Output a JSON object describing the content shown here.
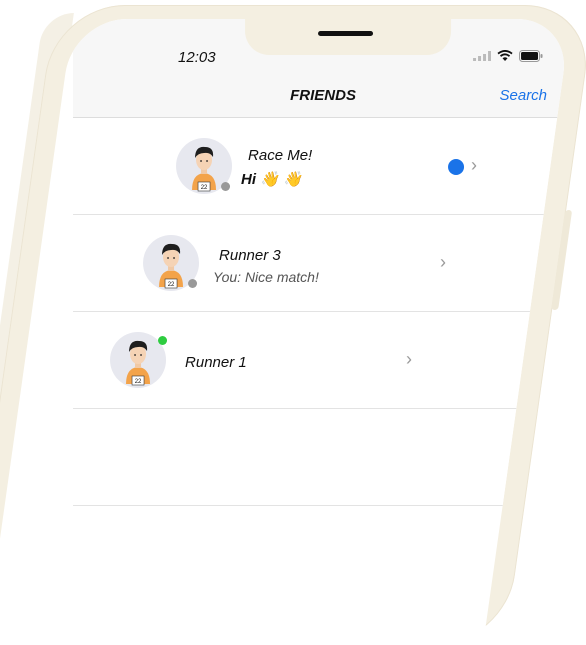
{
  "status_bar": {
    "time": "12:03"
  },
  "nav": {
    "title": "FRIENDS",
    "search_label": "Search"
  },
  "friends": [
    {
      "name": "Race Me!",
      "message": "Hi 👋 👋",
      "online": false,
      "unread": true,
      "bib": "22"
    },
    {
      "name": "Runner 3",
      "message": "You:  Nice match!",
      "online": false,
      "unread": false,
      "bib": "22"
    },
    {
      "name": "Runner 1",
      "message": "",
      "online": true,
      "unread": false,
      "bib": "22"
    }
  ],
  "colors": {
    "accent": "#1a73e8",
    "online": "#2ecc40",
    "offline": "#999999",
    "frame": "#f4efe1"
  },
  "icons": [
    "signal-icon",
    "wifi-icon",
    "battery-icon",
    "chevron-right-icon"
  ]
}
